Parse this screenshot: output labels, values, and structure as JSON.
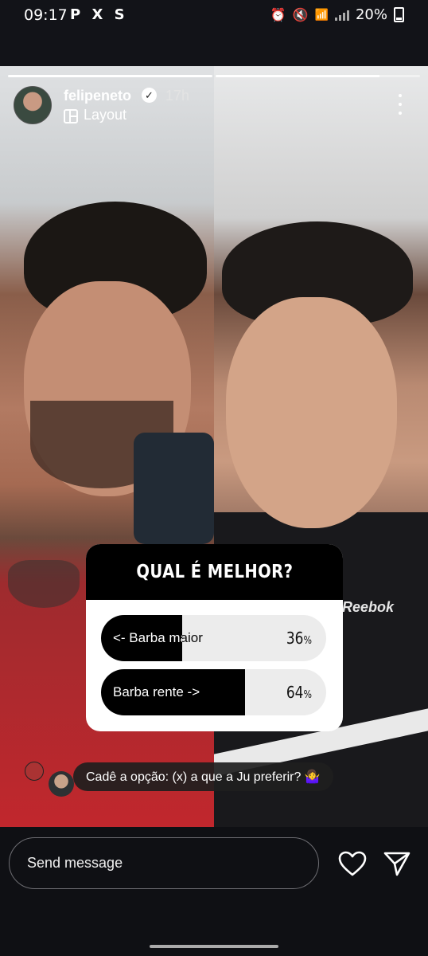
{
  "status_bar": {
    "time": "09:17",
    "apps": "P X S",
    "network": "VoLTE1",
    "battery": "20%"
  },
  "story": {
    "segments": 2,
    "active_segment": 1,
    "active_progress": 0.8,
    "username": "felipeneto",
    "verified": true,
    "time_ago": "17h",
    "layout_label": "Layout",
    "poll": {
      "question": "QUAL É MELHOR?",
      "options": [
        {
          "label": "<- Barba maior",
          "percent": 36,
          "percent_text": "36"
        },
        {
          "label": "Barba rente ->",
          "percent": 64,
          "percent_text": "64"
        }
      ],
      "percent_sign": "%"
    },
    "comment": "Cadê a opção: (x) a que a Ju preferir? 🤷‍♀️",
    "shirt_brand": "Reebok"
  },
  "composer": {
    "placeholder": "Send message"
  },
  "colors": {
    "background": "#121318",
    "poll_bar": "#000000",
    "poll_track": "#ececec"
  }
}
